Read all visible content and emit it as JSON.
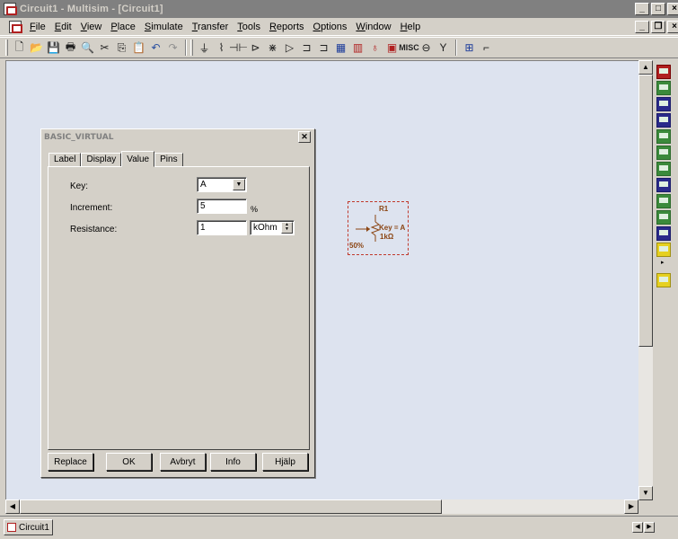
{
  "window": {
    "title": "Circuit1 - Multisim - [Circuit1]",
    "controls": [
      "_",
      "□",
      "×"
    ],
    "doc_controls": [
      "_",
      "❐",
      "×"
    ]
  },
  "menu": [
    {
      "label": "File"
    },
    {
      "label": "Edit"
    },
    {
      "label": "View"
    },
    {
      "label": "Place"
    },
    {
      "label": "Simulate"
    },
    {
      "label": "Transfer"
    },
    {
      "label": "Tools"
    },
    {
      "label": "Reports"
    },
    {
      "label": "Options"
    },
    {
      "label": "Window"
    },
    {
      "label": "Help"
    }
  ],
  "toolbar": {
    "file_icons": [
      "new-icon",
      "open-icon",
      "save-icon",
      "print-icon",
      "print-preview-icon",
      "cut-icon",
      "copy-icon",
      "paste-icon",
      "undo-icon",
      "redo-icon"
    ],
    "component_icons": [
      "source-icon",
      "resistor-icon",
      "capacitor-icon",
      "diode-icon",
      "transistor-icon",
      "analog-icon",
      "ttl-icon",
      "cmos-icon",
      "mcu-icon",
      "digital-icon",
      "indicator-icon",
      "misc-icon",
      "rf-icon",
      "electromechanical-icon",
      "hierarchy-icon",
      "bus-icon"
    ],
    "misc_label": "MISC"
  },
  "dialog": {
    "title": "BASIC_VIRTUAL",
    "tabs": [
      "Label",
      "Display",
      "Value",
      "Pins"
    ],
    "active_tab": "Value",
    "fields": {
      "key_label": "Key:",
      "key_value": "A",
      "increment_label": "Increment:",
      "increment_value": "5",
      "increment_unit": "%",
      "resistance_label": "Resistance:",
      "resistance_value": "1",
      "resistance_unit": "kOhm"
    },
    "buttons": {
      "replace": "Replace",
      "ok": "OK",
      "cancel": "Avbryt",
      "info": "Info",
      "help": "Hjälp"
    }
  },
  "component": {
    "ref": "R1",
    "key_text": "Key = A",
    "value_text": "1kΩ",
    "percent_text": "50%",
    "color": "#8b4513",
    "selection_color": "#c0392b"
  },
  "status": {
    "doc_tab": "Circuit1"
  },
  "colors": {
    "workspace": "#dde3ef",
    "chrome": "#d4d0c8",
    "titlebar_inactive": "#808080"
  }
}
